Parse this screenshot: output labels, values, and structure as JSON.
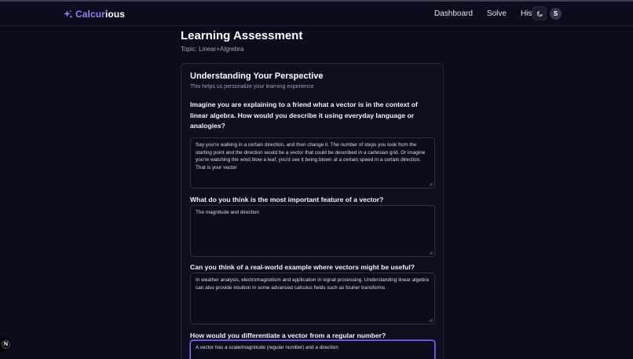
{
  "brand": {
    "name_part1": "Calcur",
    "name_part2": "ious"
  },
  "nav": {
    "links": [
      "Dashboard",
      "Solve",
      "History"
    ],
    "avatar_initial": "S"
  },
  "page": {
    "title": "Learning Assessment",
    "topic": "Topic: Linear+Algrebra"
  },
  "card": {
    "title": "Understanding Your Perspective",
    "subtitle": "This helps us personalize your learning experience"
  },
  "questions": [
    {
      "text": "Imagine you are explaining to a friend what a vector is in the context of linear algebra. How would you describe it using everyday language or analogies?",
      "answer": "Say you're walking in a certain direction, and then change it. The number of steps you took from the starting point and the direction would be a vector that could be described in a cartesian grid. Or imagine you're watching the wind blow a leaf, you'd see it being blown at a certain speed in a certain direction. That is your vector"
    },
    {
      "text": "What do you think is the most important feature of a vector?",
      "answer": "The magnitude and direction"
    },
    {
      "text": "Can you think of a real-world example where vectors might be useful?",
      "answer": "In weather analysis, electromagnetism and application in signal processing. Understanding linear algebra can also provide intuition in some advanced calculus fields such as fourier transforms"
    },
    {
      "text": "How would you differentiate a vector from a regular number?",
      "answer": "A vector has a scale/magnitude (regular number) and a direction"
    }
  ],
  "dev_badge": {
    "letter": "N"
  },
  "icons": {
    "brand": "sparkles-icon",
    "theme_toggle": "moon-icon",
    "resize": "resize-grip-icon"
  },
  "colors": {
    "background": "#0b0d1c",
    "brand_accent": "#8a84ff",
    "focus_ring": "#7c6dff"
  }
}
